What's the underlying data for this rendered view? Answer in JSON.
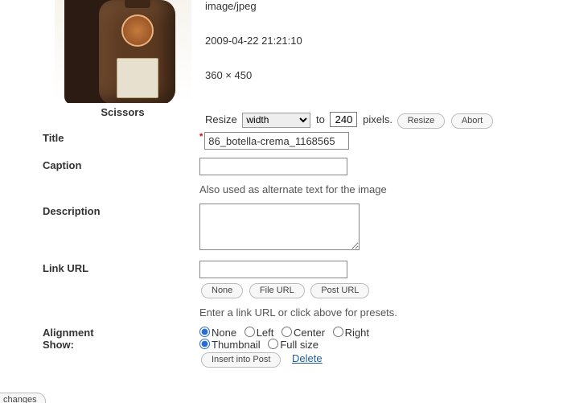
{
  "thumbnail": {
    "caption": "Scissors"
  },
  "meta": {
    "mime": "image/jpeg",
    "date": "2009-04-22 21:21:10",
    "dimensions": "360 × 450"
  },
  "resize": {
    "label": "Resize",
    "mode": "width",
    "to": "to",
    "value": "240",
    "suffix": "pixels.",
    "resize_btn": "Resize",
    "abort_btn": "Abort"
  },
  "fields": {
    "title": {
      "label": "Title",
      "value": "86_botella-crema_1168565"
    },
    "caption": {
      "label": "Caption",
      "value": "",
      "help": "Also used as alternate text for the image"
    },
    "description": {
      "label": "Description",
      "value": ""
    },
    "linkurl": {
      "label": "Link URL",
      "value": "",
      "none": "None",
      "file": "File URL",
      "post": "Post URL",
      "help": "Enter a link URL or click above for presets."
    },
    "alignment": {
      "label": "Alignment",
      "none": "None",
      "left": "Left",
      "center": "Center",
      "right": "Right",
      "selected": "none"
    },
    "show": {
      "label": "Show:",
      "thumb": "Thumbnail",
      "full": "Full size",
      "selected": "thumb"
    },
    "actions": {
      "insert": "Insert into Post",
      "delete": "Delete"
    }
  },
  "footer": {
    "changes": "changes"
  }
}
